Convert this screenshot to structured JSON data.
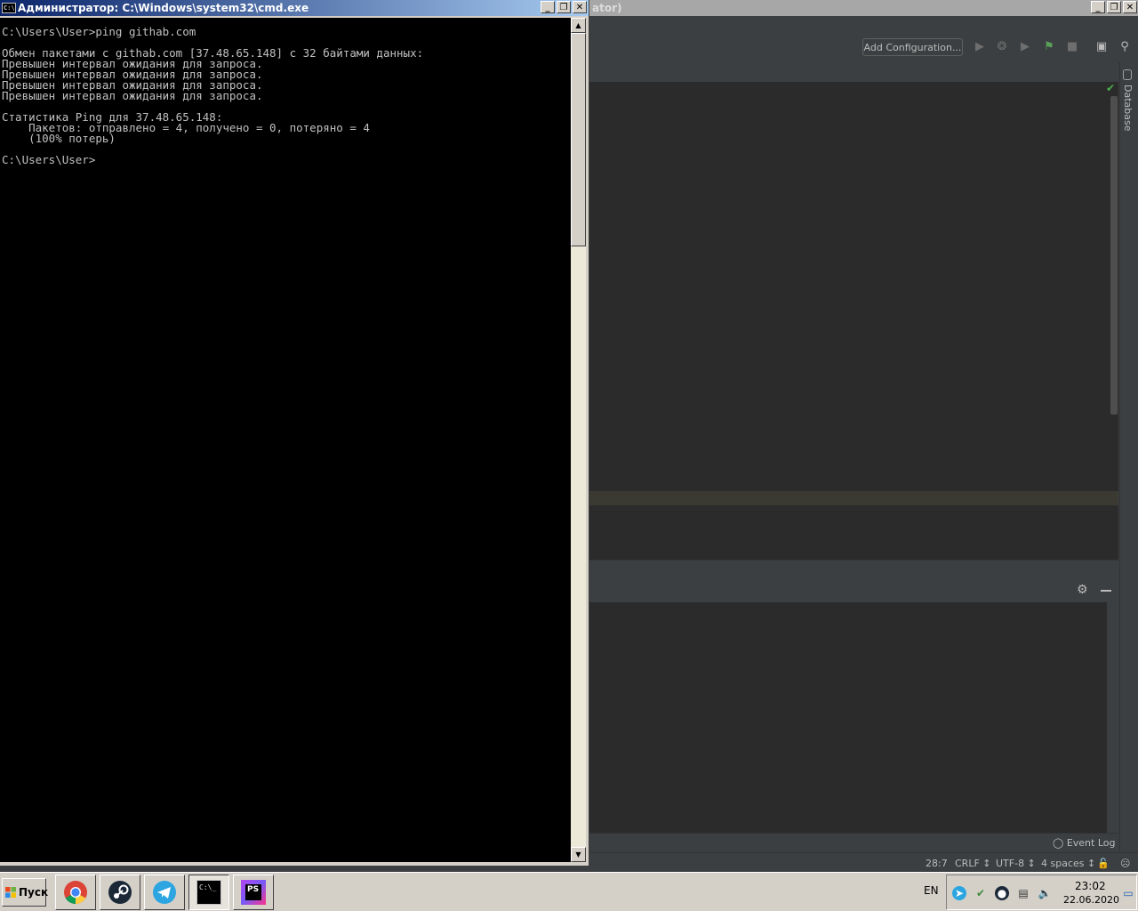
{
  "ide": {
    "title_fragment": "ator)",
    "add_configuration": "Add Configuration...",
    "database_label": "Database",
    "event_log": "Event Log",
    "status": {
      "position": "28:7",
      "line_separator": "CRLF ↕",
      "encoding": "UTF-8 ↕",
      "indent": "4 spaces ↕"
    },
    "colors": {
      "background": "#2b2b2b",
      "panel": "#3c3f41",
      "text": "#bbbbbb",
      "check": "#4caf50"
    }
  },
  "cmd": {
    "title": "Администратор: C:\\Windows\\system32\\cmd.exe",
    "icon_text": "C:\\",
    "lines": [
      "C:\\Users\\User>ping githab.com",
      "",
      "Обмен пакетами с githab.com [37.48.65.148] с 32 байтами данных:",
      "Превышен интервал ожидания для запроса.",
      "Превышен интервал ожидания для запроса.",
      "Превышен интервал ожидания для запроса.",
      "Превышен интервал ожидания для запроса.",
      "",
      "Статистика Ping для 37.48.65.148:",
      "    Пакетов: отправлено = 4, получено = 0, потеряно = 4",
      "    (100% потерь)",
      "",
      "C:\\Users\\User>"
    ],
    "colors": {
      "titlebar_start": "#0a246a",
      "titlebar_end": "#a6caf0",
      "console_bg": "#000000",
      "console_text": "#c0c0c0"
    }
  },
  "window_buttons": {
    "minimize": "_",
    "restore": "❐",
    "close": "✕"
  },
  "taskbar": {
    "start_label": "Пуск",
    "apps": [
      {
        "name": "chrome-icon",
        "active": false
      },
      {
        "name": "steam-icon",
        "active": false
      },
      {
        "name": "telegram-icon",
        "active": false
      },
      {
        "name": "cmd-icon",
        "active": true,
        "label": "C:\\_"
      },
      {
        "name": "phpstorm-icon",
        "active": false,
        "label": "PS"
      }
    ],
    "language": "EN",
    "clock_time": "23:02",
    "clock_date": "22.06.2020"
  }
}
